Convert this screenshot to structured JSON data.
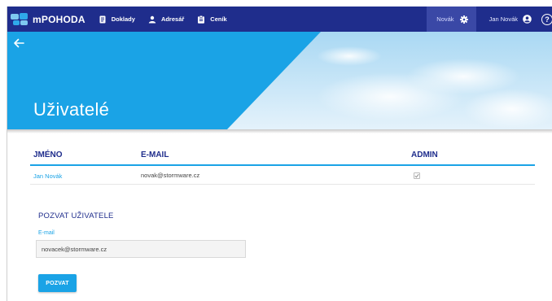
{
  "app": {
    "brand": "mPOHODA"
  },
  "nav": {
    "items": [
      {
        "label": "Doklady",
        "icon": "document-icon"
      },
      {
        "label": "Adresář",
        "icon": "person-icon"
      },
      {
        "label": "Ceník",
        "icon": "clipboard-icon"
      }
    ],
    "company": "Novák",
    "company_icon": "gear-icon",
    "user": "Jan Novák",
    "user_icon": "account-circle-icon",
    "help_icon": "help-circle-icon",
    "help_glyph": "?"
  },
  "hero": {
    "back_icon": "back-arrow-icon",
    "title": "Uživatelé"
  },
  "table": {
    "columns": [
      "JMÉNO",
      "E-MAIL",
      "ADMIN"
    ],
    "rows": [
      {
        "name": "Jan Novák",
        "email": "novak@stormware.cz",
        "admin": true
      }
    ]
  },
  "invite": {
    "title": "POZVAT UŽIVATELE",
    "email_label": "E-mail",
    "email_value": "novacek@stormware.cz",
    "button_label": "POZVAT"
  },
  "colors": {
    "nav_bg": "#1f2d8c",
    "accent": "#1aa3e6",
    "heading": "#1f2d8c"
  }
}
